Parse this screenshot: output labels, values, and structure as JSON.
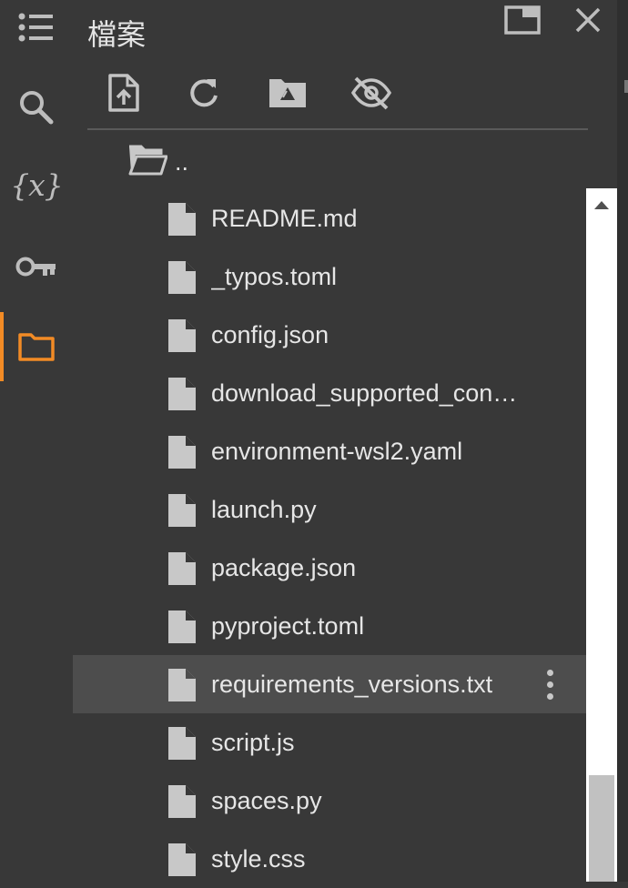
{
  "panel": {
    "title": "檔案"
  },
  "rail": {
    "items": [
      {
        "name": "table-of-contents",
        "icon": "list-icon"
      },
      {
        "name": "search",
        "icon": "search-icon"
      },
      {
        "name": "variables",
        "icon": "variables-icon",
        "glyph": "{x}"
      },
      {
        "name": "secrets",
        "icon": "key-icon"
      },
      {
        "name": "files",
        "icon": "folder-icon",
        "active": true
      }
    ],
    "active_color": "#f28b25"
  },
  "window_controls": [
    {
      "name": "new-window",
      "icon": "window-icon"
    },
    {
      "name": "close",
      "icon": "close-icon"
    }
  ],
  "toolbar": [
    {
      "name": "upload",
      "icon": "file-upload-icon"
    },
    {
      "name": "refresh",
      "icon": "refresh-icon"
    },
    {
      "name": "mount-drive",
      "icon": "drive-folder-icon"
    },
    {
      "name": "toggle-hidden",
      "icon": "eye-off-icon"
    }
  ],
  "files": {
    "parent": "..",
    "items": [
      {
        "label": "README.md"
      },
      {
        "label": "_typos.toml"
      },
      {
        "label": "config.json"
      },
      {
        "label": "download_supported_con…"
      },
      {
        "label": "environment-wsl2.yaml"
      },
      {
        "label": "launch.py"
      },
      {
        "label": "package.json"
      },
      {
        "label": "pyproject.toml"
      },
      {
        "label": "requirements_versions.txt",
        "selected": true
      },
      {
        "label": "script.js"
      },
      {
        "label": "spaces.py"
      },
      {
        "label": "style.css"
      }
    ]
  },
  "scrollbar": {
    "position_fraction": 0.85
  }
}
